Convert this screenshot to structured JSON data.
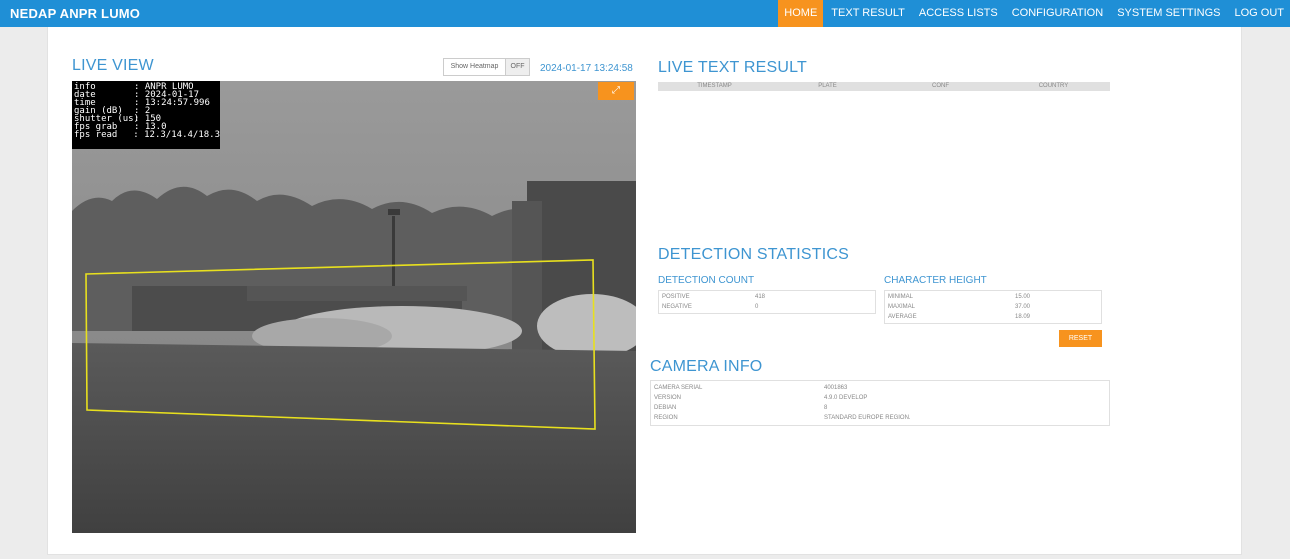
{
  "app": {
    "title": "NEDAP ANPR LUMO"
  },
  "nav": [
    {
      "label": "HOME",
      "active": true
    },
    {
      "label": "TEXT RESULT",
      "active": false
    },
    {
      "label": "ACCESS LISTS",
      "active": false
    },
    {
      "label": "CONFIGURATION",
      "active": false
    },
    {
      "label": "SYSTEM SETTINGS",
      "active": false
    },
    {
      "label": "LOG OUT",
      "active": false
    }
  ],
  "live_view": {
    "title": "LIVE VIEW",
    "heatmap_label": "Show Heatmap",
    "heatmap_state": "OFF",
    "timestamp": "2024-01-17 13:24:58",
    "overlay": [
      {
        "key": "info",
        "value": ": ANPR LUMO"
      },
      {
        "key": "date",
        "value": ": 2024-01-17"
      },
      {
        "key": "time",
        "value": ": 13:24:57.996"
      },
      {
        "key": "gain (dB)",
        "value": ": 2"
      },
      {
        "key": "shutter (us)",
        "value": ": 150"
      },
      {
        "key": "fps grab",
        "value": ": 13.0"
      },
      {
        "key": "fps read",
        "value": ": 12.3/14.4/18.3"
      }
    ],
    "expand_icon": "⤢"
  },
  "live_text_result": {
    "title": "LIVE TEXT RESULT",
    "columns": [
      "TIMESTAMP",
      "PLATE",
      "CONF",
      "COUNTRY"
    ]
  },
  "detection_statistics": {
    "title": "DETECTION STATISTICS",
    "count_title": "DETECTION COUNT",
    "count_rows": [
      {
        "label": "POSITIVE",
        "value": "418"
      },
      {
        "label": "NEGATIVE",
        "value": "0"
      }
    ],
    "height_title": "CHARACTER HEIGHT",
    "height_rows": [
      {
        "label": "MINIMAL",
        "value": "15.00"
      },
      {
        "label": "MAXIMAL",
        "value": "37.00"
      },
      {
        "label": "AVERAGE",
        "value": "18.09"
      }
    ],
    "reset_label": "RESET"
  },
  "camera_info": {
    "title": "CAMERA INFO",
    "rows": [
      {
        "label": "CAMERA SERIAL",
        "value": "4001863"
      },
      {
        "label": "VERSION",
        "value": "4.9.0 DEVELOP"
      },
      {
        "label": "DEBIAN",
        "value": "8"
      },
      {
        "label": "REGION",
        "value": "STANDARD EUROPE REGION."
      }
    ]
  },
  "colors": {
    "brand": "#1f8fd6",
    "accent": "#f7931e",
    "title": "#3e95d1",
    "roi": "#e8e01e"
  }
}
